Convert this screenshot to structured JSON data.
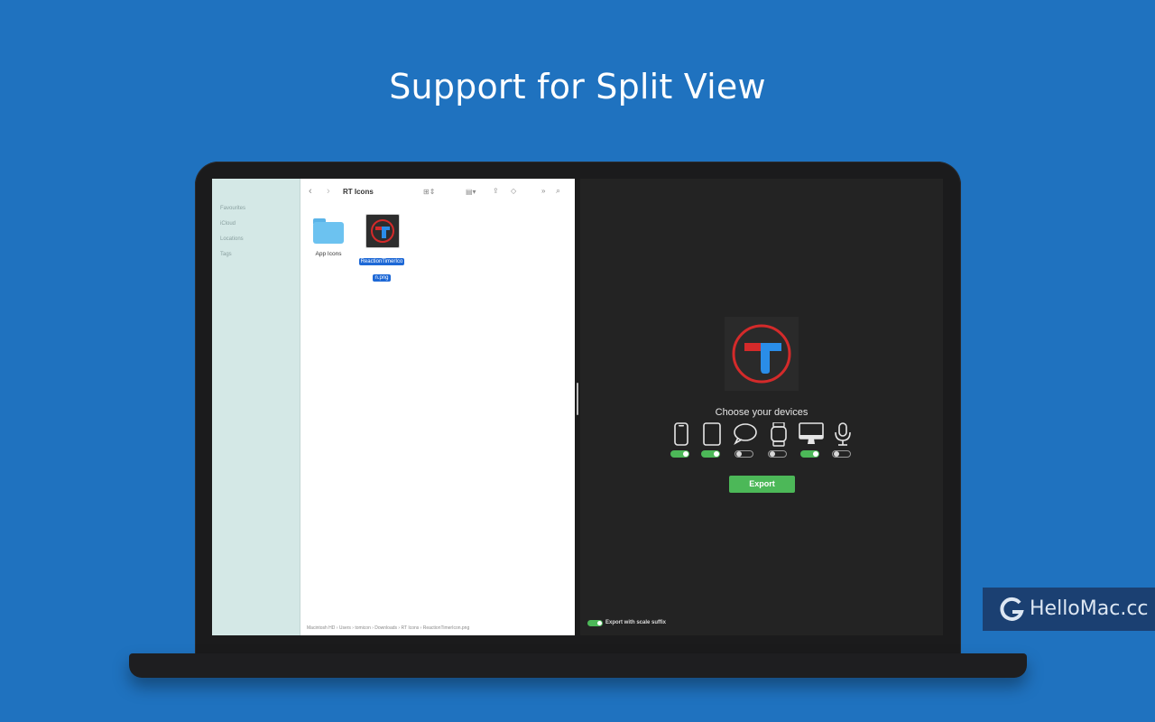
{
  "headline": "Support for Split View",
  "finder": {
    "sidebar": [
      "Favourites",
      "iCloud",
      "Locations",
      "Tags"
    ],
    "title": "RT Icons",
    "files": [
      {
        "name": "App Icons",
        "kind": "folder"
      },
      {
        "name_line1": "ReactionTimerIco",
        "name_line2": "n.png",
        "kind": "image",
        "selected": true
      }
    ],
    "pathbar": "Macintosh HD  ›  Users  ›  tomicon  ›  Downloads  ›  RT Icons  ›  ReactionTimerIcon.png"
  },
  "app": {
    "choose_label": "Choose your devices",
    "devices": [
      {
        "name": "iPhone",
        "enabled": true
      },
      {
        "name": "iPad",
        "enabled": true
      },
      {
        "name": "iMessage",
        "enabled": false
      },
      {
        "name": "Apple Watch",
        "enabled": false
      },
      {
        "name": "Mac",
        "enabled": true
      },
      {
        "name": "Microphone",
        "enabled": false
      }
    ],
    "export_label": "Export",
    "scale_suffix_label": "Export with scale suffix",
    "scale_suffix_enabled": true
  },
  "watermark": "HelloMac.cc",
  "colors": {
    "background": "#1f72bf",
    "toggle_on": "#4cb858",
    "selection": "#1d68d6"
  }
}
